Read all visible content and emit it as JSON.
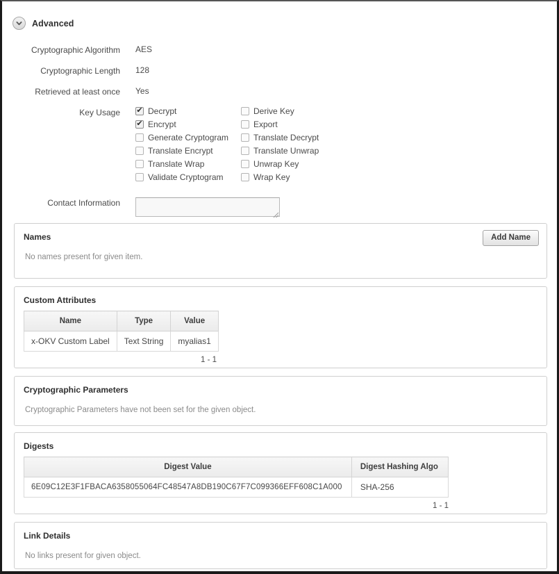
{
  "section": {
    "title": "Advanced",
    "disclosure_icon": "chevron-down-icon"
  },
  "properties": [
    {
      "label": "Cryptographic Algorithm",
      "value": "AES"
    },
    {
      "label": "Cryptographic Length",
      "value": "128"
    },
    {
      "label": "Retrieved at least once",
      "value": "Yes"
    }
  ],
  "key_usage": {
    "label": "Key Usage",
    "items": [
      {
        "label": "Decrypt",
        "checked": true
      },
      {
        "label": "Derive Key",
        "checked": false
      },
      {
        "label": "Encrypt",
        "checked": true
      },
      {
        "label": "Export",
        "checked": false
      },
      {
        "label": "Generate Cryptogram",
        "checked": false
      },
      {
        "label": "Translate Decrypt",
        "checked": false
      },
      {
        "label": "Translate Encrypt",
        "checked": false
      },
      {
        "label": "Translate Unwrap",
        "checked": false
      },
      {
        "label": "Translate Wrap",
        "checked": false
      },
      {
        "label": "Unwrap Key",
        "checked": false
      },
      {
        "label": "Validate Cryptogram",
        "checked": false
      },
      {
        "label": "Wrap Key",
        "checked": false
      }
    ]
  },
  "contact_information": {
    "label": "Contact Information",
    "value": "",
    "placeholder": ""
  },
  "names_panel": {
    "title": "Names",
    "add_button": "Add Name",
    "empty_message": "No names present for given item."
  },
  "custom_attributes_panel": {
    "title": "Custom Attributes",
    "columns": [
      "Name",
      "Type",
      "Value"
    ],
    "rows": [
      [
        "x-OKV Custom Label",
        "Text String",
        "myalias1"
      ]
    ],
    "pager": "1 - 1"
  },
  "cryptographic_parameters_panel": {
    "title": "Cryptographic Parameters",
    "empty_message": "Cryptographic Parameters have not been set for the given object."
  },
  "digests_panel": {
    "title": "Digests",
    "columns": [
      "Digest Value",
      "Digest Hashing Algo"
    ],
    "rows": [
      [
        "6E09C12E3F1FBACA6358055064FC48547A8DB190C67F7C099366EFF608C1A000",
        "SHA-256"
      ]
    ],
    "pager": "1 - 1"
  },
  "link_details_panel": {
    "title": "Link Details",
    "empty_message": "No links present for given object."
  },
  "colors": {
    "panel_border": "#cfcfcf",
    "text": "#4a4a4a",
    "muted_text": "#8a8a8a",
    "frame": "#1a1a1a"
  }
}
